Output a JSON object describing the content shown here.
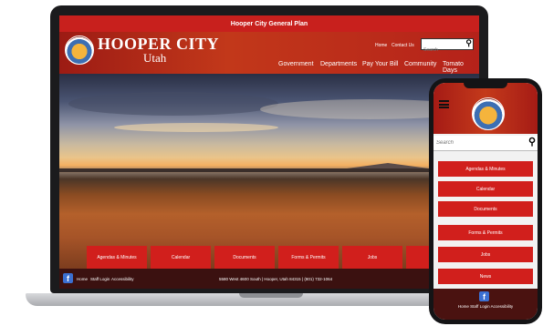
{
  "laptop": {
    "top_bar_title": "Hooper City General Plan",
    "site_title": "HOOPER CITY",
    "site_subtitle": "Utah",
    "utility_links": [
      "Home",
      "Contact Us"
    ],
    "search_placeholder": "Search",
    "nav": [
      "Government",
      "Departments",
      "Pay Your Bill",
      "Community",
      "Tomato Days"
    ],
    "tiles": [
      "Agendas & Minutes",
      "Calendar",
      "Documents",
      "Forms & Permits",
      "Jobs"
    ],
    "footer_links": [
      "Home",
      "Staff Login",
      "Accessibility"
    ],
    "footer_address": "5580 West 4600 South | Hooper, Utah 84315 | (801) 732-1064"
  },
  "phone": {
    "search_placeholder": "Search",
    "buttons": [
      "Agendas & Minutes",
      "Calendar",
      "Documents",
      "Forms & Permits",
      "Jobs",
      "News"
    ],
    "footer_links": [
      "Home",
      "Staff Login",
      "Accessibility"
    ]
  },
  "colors": {
    "brand_red": "#d11f1c",
    "header_red": "#b5221a",
    "footer_maroon": "#3b1110",
    "facebook_blue": "#3b6fd1"
  },
  "icons": {
    "search": "search-icon",
    "facebook": "facebook-icon",
    "menu": "hamburger-menu-icon",
    "logo": "city-seal-logo"
  }
}
